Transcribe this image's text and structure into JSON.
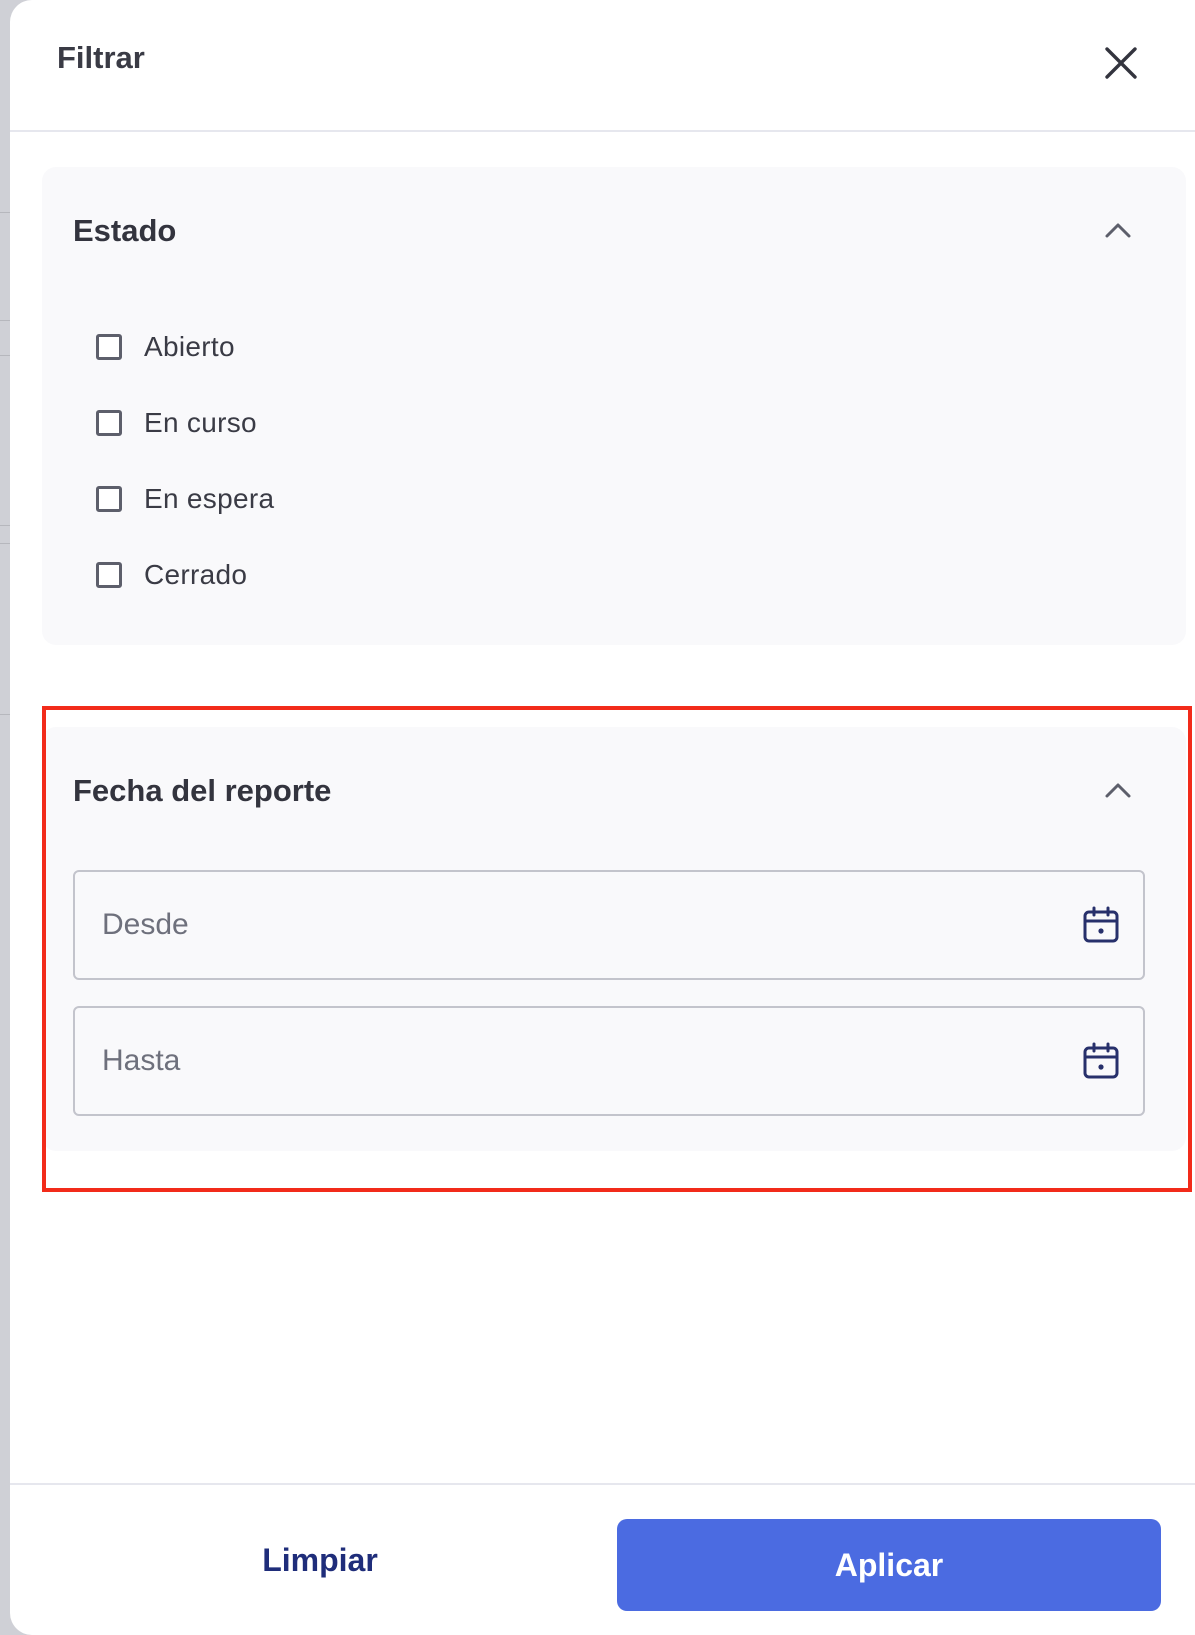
{
  "header": {
    "title": "Filtrar"
  },
  "estado": {
    "title": "Estado",
    "options": [
      {
        "label": "Abierto",
        "checked": false
      },
      {
        "label": "En curso",
        "checked": false
      },
      {
        "label": "En espera",
        "checked": false
      },
      {
        "label": "Cerrado",
        "checked": false
      }
    ]
  },
  "fecha": {
    "title": "Fecha del reporte",
    "from": {
      "placeholder": "Desde",
      "value": ""
    },
    "to": {
      "placeholder": "Hasta",
      "value": ""
    }
  },
  "footer": {
    "clear_label": "Limpiar",
    "apply_label": "Aplicar"
  },
  "icons": {
    "close": "close-icon",
    "collapse": "chevron-up-icon",
    "calendar": "calendar-icon"
  },
  "colors": {
    "accent": "#4b6be1",
    "clear_text": "#1f2d7a",
    "highlight": "#f22b1a",
    "calendar_icon": "#27306b"
  }
}
